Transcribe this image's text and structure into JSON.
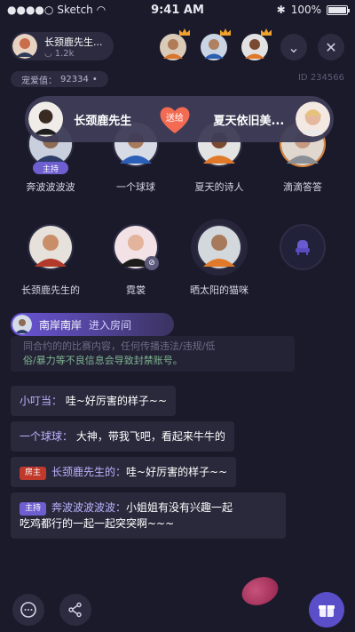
{
  "status": {
    "carrier": "Sketch",
    "time": "9:41 AM",
    "battery": "100%"
  },
  "host": {
    "name": "长颈鹿先生...",
    "fans": "1.2k"
  },
  "favorability": {
    "label": "宠爱值：",
    "value": "92334"
  },
  "room": {
    "id": "ID 234566"
  },
  "gift": {
    "sender": "长颈鹿先生",
    "action": "送给",
    "receiver": "夏天依旧美..."
  },
  "seats": [
    {
      "name": "奔波波波波",
      "role": "主持"
    },
    {
      "name": "一个球球"
    },
    {
      "name": "夏天的诗人"
    },
    {
      "name": "滴滴答答"
    },
    {
      "name": "长颈鹿先生的"
    },
    {
      "name": "霓裳"
    },
    {
      "name": "晒太阳的猫咪"
    },
    {
      "name": ""
    }
  ],
  "join": {
    "user": "南岸南岸",
    "action": "进入房间"
  },
  "notice": {
    "line1": "同合约的的比赛内容，任何传播违法/违规/低",
    "line2": "俗/暴力等不良信息会导致封禁账号。"
  },
  "messages": [
    {
      "user": "小叮当",
      "text": "哇~好厉害的样子~~"
    },
    {
      "user": "一个球球",
      "text": "大神，带我飞吧，看起来牛牛的"
    },
    {
      "tag": "房主",
      "user": "长颈鹿先生的",
      "text": "哇~好厉害的样子~~"
    },
    {
      "tag": "主持",
      "user": "奔波波波波波",
      "text": "小姐姐有没有兴趣一起",
      "text2": "吃鸡都行的一起一起突突啊~~~"
    }
  ],
  "colors": {
    "accent": "#6d5fcf",
    "heart": "#f36b52",
    "owner_tag": "#c0392b",
    "host_tag": "#6d5fcf"
  }
}
